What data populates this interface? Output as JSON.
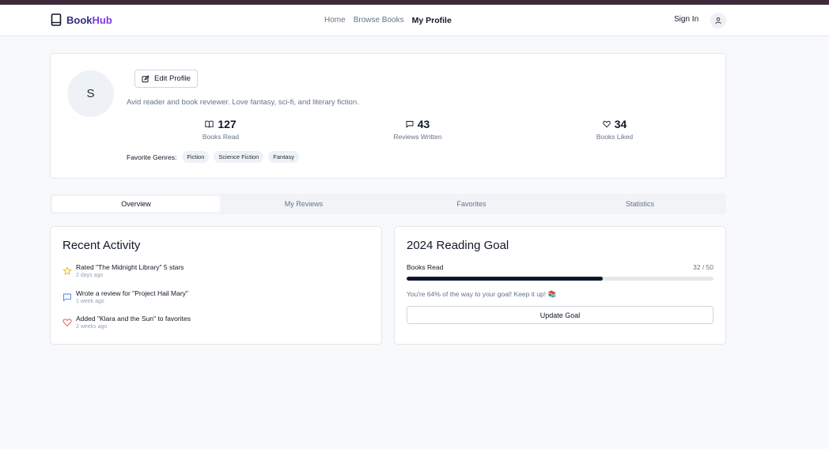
{
  "header": {
    "brand_book": "Book",
    "brand_hub": "Hub",
    "nav": [
      "Home",
      "Browse Books",
      "My Profile"
    ],
    "active_nav": "My Profile",
    "sign_in": "Sign In"
  },
  "profile": {
    "avatar_initial": "S",
    "edit_label": "Edit Profile",
    "bio": "Avid reader and book reviewer. Love fantasy, sci-fi, and literary fiction.",
    "stats": [
      {
        "value": "127",
        "label": "Books Read",
        "icon": "book-open-icon"
      },
      {
        "value": "43",
        "label": "Reviews Written",
        "icon": "message-square-icon"
      },
      {
        "value": "34",
        "label": "Books Liked",
        "icon": "heart-icon"
      }
    ],
    "genres_label": "Favorite Genres:",
    "genres": [
      "Fiction",
      "Science Fiction",
      "Fantasy"
    ]
  },
  "tabs": [
    "Overview",
    "My Reviews",
    "Favorites",
    "Statistics"
  ],
  "active_tab": "Overview",
  "activity": {
    "title": "Recent Activity",
    "items": [
      {
        "text": "Rated \"The Midnight Library\" 5 stars",
        "time": "2 days ago",
        "icon": "star-icon",
        "color": "#eab308"
      },
      {
        "text": "Wrote a review for \"Project Hail Mary\"",
        "time": "1 week ago",
        "icon": "message-square-icon",
        "color": "#3b82f6"
      },
      {
        "text": "Added \"Klara and the Sun\" to favorites",
        "time": "2 weeks ago",
        "icon": "heart-icon",
        "color": "#ef4444"
      }
    ]
  },
  "goal": {
    "title": "2024 Reading Goal",
    "label": "Books Read",
    "count": "32 / 50",
    "progress_fraction": 0.64,
    "message": "You're 64% of the way to your goal! Keep it up! 📚",
    "button": "Update Goal"
  }
}
